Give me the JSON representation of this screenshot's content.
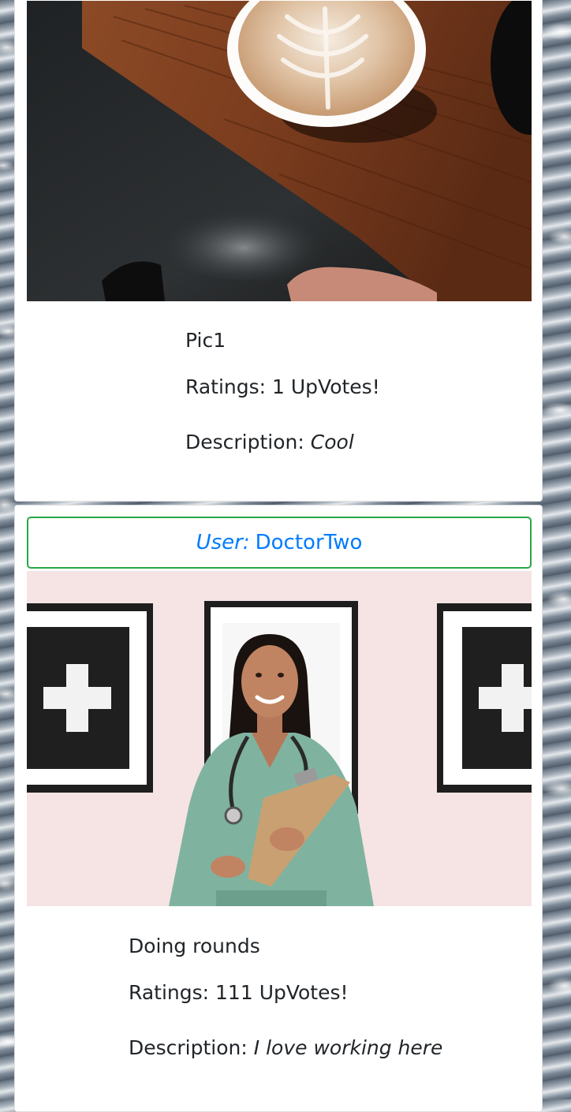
{
  "posts": [
    {
      "title": "Pic1",
      "ratings_label": "Ratings:",
      "ratings_count": "1",
      "ratings_suffix": "UpVotes!",
      "description_label": "Description:",
      "description": "Cool",
      "image_subject": "latte-art-coffee-cup-on-wooden-table"
    },
    {
      "user_label": "User:",
      "user_name": "DoctorTwo",
      "title": "Doing rounds",
      "ratings_label": "Ratings:",
      "ratings_count": "111",
      "ratings_suffix": "UpVotes!",
      "description_label": "Description:",
      "description": "I love working here",
      "image_subject": "smiling-doctor-holding-clipboard"
    }
  ],
  "colors": {
    "link": "#007bff",
    "user_border": "#28a745",
    "text": "#212529",
    "card_bg": "#ffffff"
  }
}
